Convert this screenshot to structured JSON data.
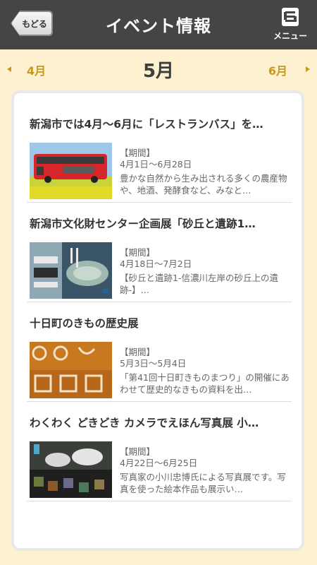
{
  "header": {
    "back_label": "もどる",
    "title": "イベント情報",
    "menu_label": "メニュー"
  },
  "month_nav": {
    "prev": "4月",
    "current": "5月",
    "next": "6月"
  },
  "events": [
    {
      "title": "新潟市では4月〜6月に「レストランバス」を…",
      "period_label": "【期間】",
      "period": "4月1日〜6月28日",
      "desc": "豊かな自然から生み出される多くの農産物や、地酒、発酵食など、みなと…"
    },
    {
      "title": "新潟市文化財センター企画展「砂丘と遺跡1…",
      "period_label": "【期間】",
      "period": "4月18日〜7月2日",
      "desc": "【砂丘と遺跡1-信濃川左岸の砂丘上の遺跡-】…"
    },
    {
      "title": "十日町のきもの歴史展",
      "period_label": "【期間】",
      "period": "5月3日〜5月4日",
      "desc": "「第41回十日町きものまつり」の開催にあわせて歴史的なきもの資料を出…"
    },
    {
      "title": "わくわく どきどき カメラでえほん写真展 小…",
      "period_label": "【期間】",
      "period": "4月22日〜6月25日",
      "desc": "写真家の小川忠博氏による写真展です。写真を使った絵本作品も展示い…"
    }
  ],
  "colors": {
    "header_bg": "#454545",
    "background": "#fdf1cf",
    "month_accent": "#c79a1e"
  }
}
